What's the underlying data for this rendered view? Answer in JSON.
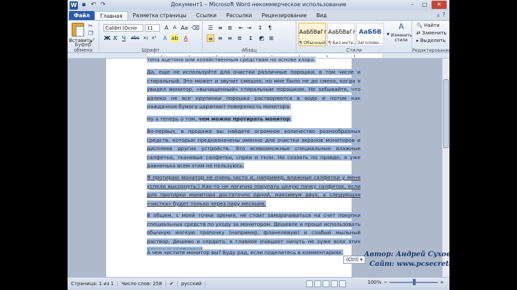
{
  "window": {
    "title": "Документ1 – Microsoft Word некоммерческое использование",
    "app_logo": "W",
    "controls": [
      "–",
      "□",
      "✕"
    ]
  },
  "qat": [
    "save-icon",
    "undo-icon",
    "redo-icon"
  ],
  "tabs": [
    "Файл",
    "Главная",
    "Разметка страницы",
    "Ссылки",
    "Рассылки",
    "Рецензирование",
    "Вид"
  ],
  "active_tab": "Главная",
  "ribbon": {
    "clipboard": {
      "paste": "Вставить",
      "label": "Буфер обмена"
    },
    "font": {
      "family": "Calibri (Осно",
      "size": "11",
      "label": "Шрифт",
      "buttons": [
        "Ж",
        "К",
        "Ч",
        "abc",
        "x₂",
        "x²"
      ]
    },
    "paragraph": {
      "label": "Абзац"
    },
    "styles": {
      "label": "Стили",
      "items": [
        {
          "sample": "АаБбВвГг",
          "name": "¶ Обычный"
        },
        {
          "sample": "АаБбВвГг",
          "name": "¶ Без инте..."
        },
        {
          "sample": "АаБбВ",
          "name": "Заголово..."
        }
      ],
      "change": "Изменить стили"
    },
    "editing": {
      "label": "Редактирование",
      "find": "Найти",
      "replace": "Заменить",
      "select": "Выделить"
    }
  },
  "document": {
    "p0": "типа ацетона или хозяйственным средствам на основе хлора.",
    "p1": "Да, еще не используйте для очистки различные порошки, в том числе и стиральный. Это может и звучит смешно, но мне было не до смеха, когда я увидел монитор, «вычищенный» стиральным порошком. Не забывайте, что далеко не все крупинки порошка растворяются в воде и потом как наждачная бумага царапают поверхность монитора.",
    "p2_pre": "Ну а теперь о том, ",
    "p2_bold": "чем можно протирать монитор",
    "p2_post": ".",
    "p3": "Во-первых, в продаже вы найдете огромное количество разнообразных средств, которые предназначены именно для очистки экранов мониторов и дисплеев других устройств. Это всевозможные специальные влажные салфетки, тканевые салфетки, спреи и гели. Но сказать по правде, я уже давненько всем этим не пользуюсь.",
    "p4": "Я протираю монитор не очень часто и, например, влажные салфетки у меня успели высохнуть:) Как-то не логично покупать целую пачку салфеток, если для протирки монитора достаточно одной, максимум двух, а следующая «чистка» будет только через пару месяцев.",
    "p5": "В общем, с моей точки зрения, не стоит заморачиваться на счет покупки специальных средств по уходу за монитором. Дешевле и проще использовать обычную мягкую тряпочку (например, фланелевую) и слабый мыльный раствор. Дешево и сердито, а главное очищает ничуть не хуже всех этих влажных салфеток:)",
    "p6": "А чем чистите монитор вы? Буду рад, если поделитесь в комментариях."
  },
  "paste_tag": "(Ctrl) ▾",
  "watermark": {
    "author": "Автор: Андрей Сухов",
    "site": "Сайт: www.pcsecrets.ru"
  },
  "status": {
    "page": "Страница: 1 из 1",
    "words": "Число слов: 258",
    "lang": "русский",
    "zoom": "100%"
  }
}
